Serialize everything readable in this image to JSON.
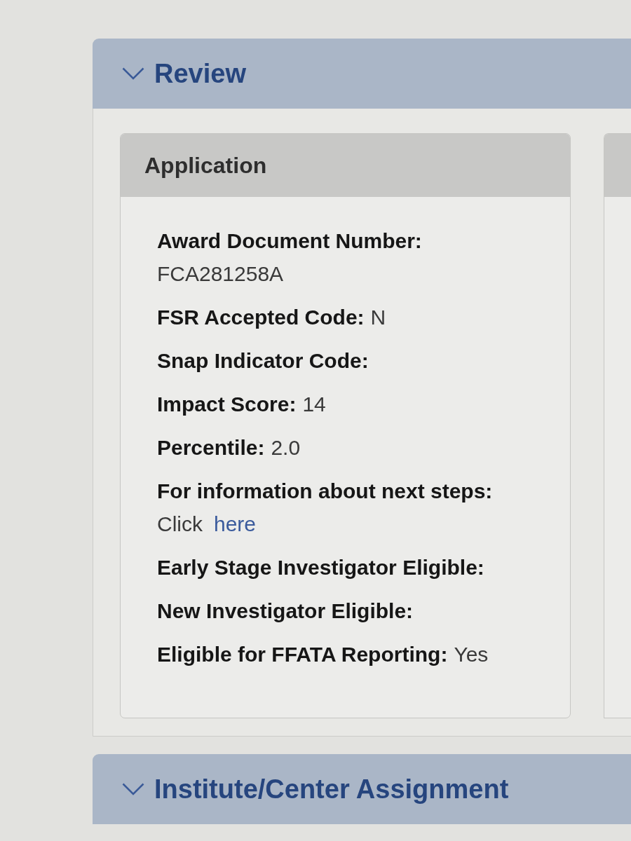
{
  "sections": [
    {
      "title": "Review",
      "expanded": true,
      "cards": [
        {
          "kind": "details",
          "title": "Application",
          "fields": [
            {
              "kind": "stacked",
              "label": "Award Document Number:",
              "value": "FCA281258A"
            },
            {
              "kind": "inline",
              "label": "FSR Accepted Code:",
              "value": "N"
            },
            {
              "kind": "inline",
              "label": "Snap Indicator Code:"
            },
            {
              "kind": "inline",
              "label": "Impact Score:",
              "value": "14"
            },
            {
              "kind": "inline",
              "label": "Percentile:",
              "value": "2.0"
            },
            {
              "kind": "link",
              "label": "For information about next steps:",
              "value": "Click",
              "link": "here"
            },
            {
              "kind": "inline",
              "label": "Early Stage Investigator Eligible:"
            },
            {
              "kind": "inline",
              "label": "New Investigator Eligible:"
            },
            {
              "kind": "inline",
              "label": "Eligible for FFATA Reporting:",
              "value": "Yes"
            }
          ]
        },
        {
          "kind": "cut_off"
        }
      ]
    },
    {
      "title": "Institute/Center Assignment",
      "expanded": true
    }
  ]
}
